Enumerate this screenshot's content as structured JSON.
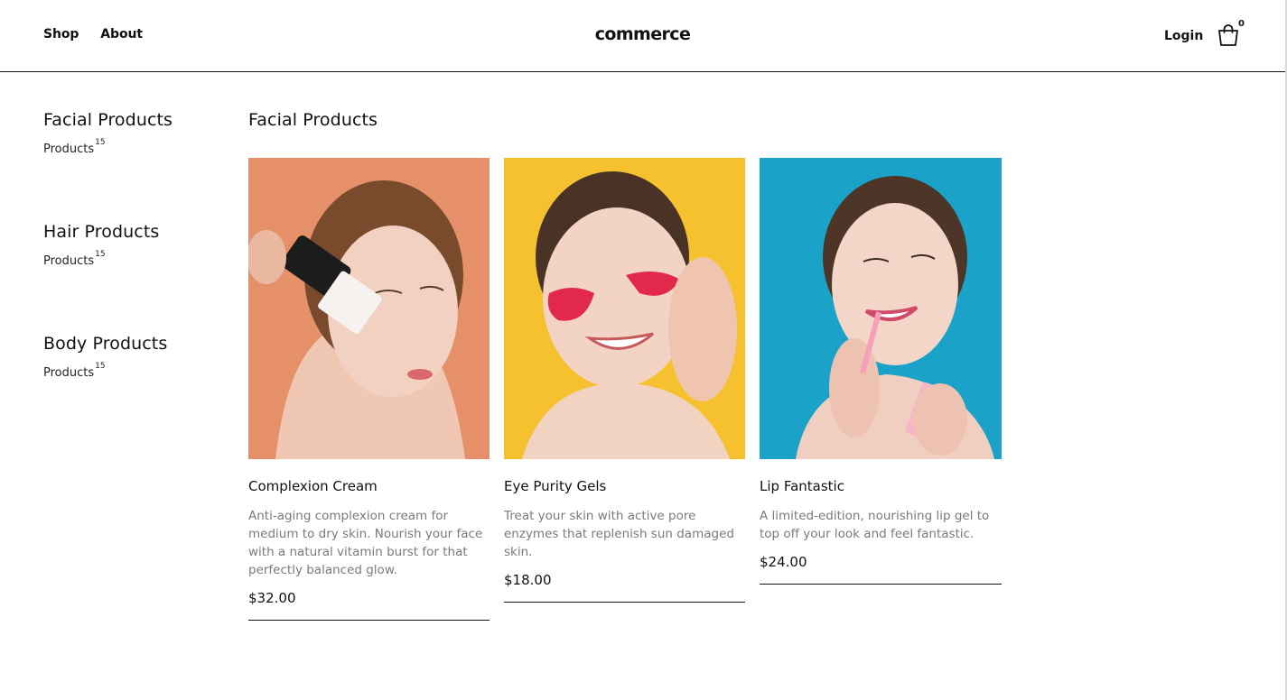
{
  "header": {
    "nav": [
      "Shop",
      "About"
    ],
    "logo": "commerce",
    "login": "Login",
    "cart_count": "0"
  },
  "sidebar": {
    "categories": [
      {
        "title": "Facial Products",
        "link": "Products",
        "count": "15"
      },
      {
        "title": "Hair Products",
        "link": "Products",
        "count": "15"
      },
      {
        "title": "Body Products",
        "link": "Products",
        "count": "15"
      }
    ]
  },
  "main": {
    "title": "Facial Products",
    "products": [
      {
        "name": "Complexion Cream",
        "description": "Anti-aging complexion cream for medium to dry skin. Nourish your face with a natural vitamin burst for that perfectly balanced glow.",
        "price": "$32.00",
        "bg_color": "#e6906a"
      },
      {
        "name": "Eye Purity Gels",
        "description": "Treat your skin with active pore enzymes that replenish sun damaged skin.",
        "price": "$18.00",
        "bg_color": "#f6c12f"
      },
      {
        "name": "Lip Fantastic",
        "description": "A limited-edition, nourishing lip gel to top off your look and feel fantastic.",
        "price": "$24.00",
        "bg_color": "#1aa2c9"
      }
    ]
  }
}
